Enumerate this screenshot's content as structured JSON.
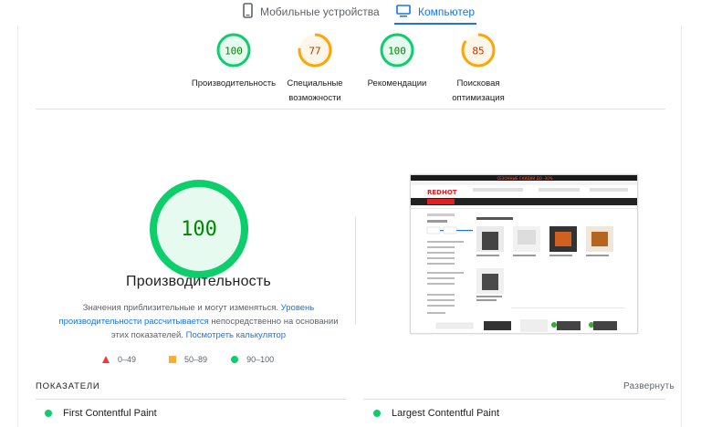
{
  "tabs": {
    "mobile_label": "Мобильные устройства",
    "desktop_label": "Компьютер"
  },
  "summary": [
    {
      "score": "100",
      "label_line1": "Производительность",
      "label_line2": "",
      "status": "pass",
      "color": "#0cce6b",
      "fraction": 1.0
    },
    {
      "score": "77",
      "label_line1": "Специальные",
      "label_line2": "возможности",
      "status": "average",
      "color": "#ffa400",
      "fraction": 0.77
    },
    {
      "score": "100",
      "label_line1": "Рекомендации",
      "label_line2": "",
      "status": "pass",
      "color": "#0cce6b",
      "fraction": 1.0
    },
    {
      "score": "85",
      "label_line1": "Поисковая",
      "label_line2": "оптимизация",
      "status": "average",
      "color": "#ffa400",
      "fraction": 0.85
    }
  ],
  "performance": {
    "score": "100",
    "title": "Производительность",
    "desc_part1": "Значения приблизительные и могут изменяться. ",
    "desc_link1": "Уровень производительности рассчитывается",
    "desc_part2": " непосредственно на основании этих показателей. ",
    "desc_link2": "Посмотреть калькулятор",
    "fraction": 1.0
  },
  "legend": {
    "fail": "0–49",
    "average": "50–89",
    "pass": "90–100"
  },
  "thumbnail": {
    "promo": "СЕЗОННЫЕ СКИДКИ ДО -30%",
    "logo": "REDHOT"
  },
  "metrics": {
    "header": "ПОКАЗАТЕЛИ",
    "expand": "Развернуть",
    "items": [
      {
        "label": "First Contentful Paint"
      },
      {
        "label": "Largest Contentful Paint"
      }
    ]
  },
  "colors": {
    "pass": "#0cce6b",
    "average": "#ffa400",
    "fail": "#ff3333",
    "accent": "#1a73e8"
  }
}
